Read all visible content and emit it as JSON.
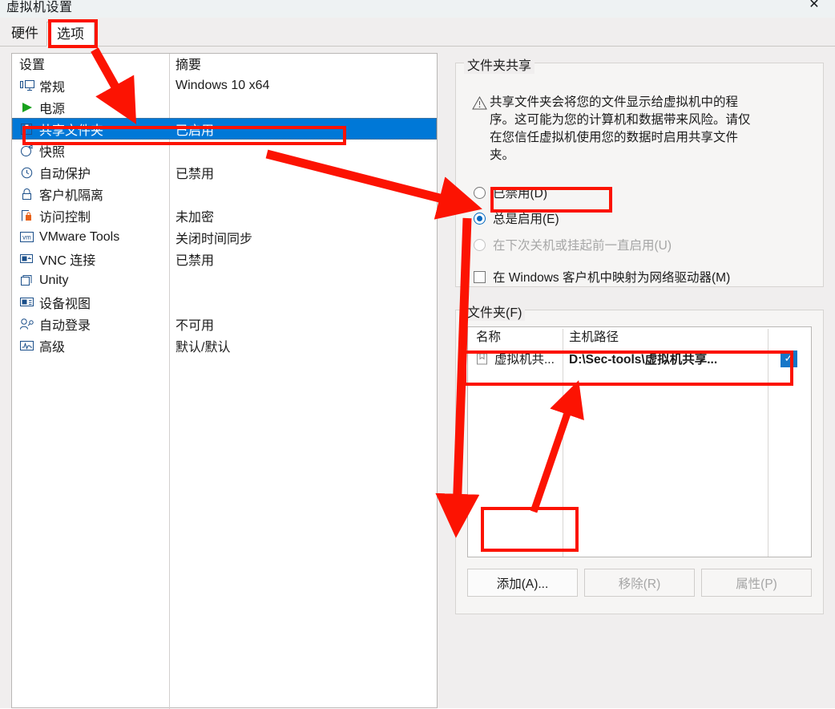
{
  "window": {
    "title": "虚拟机设置",
    "close_label": "✕"
  },
  "tabs": [
    {
      "label": "硬件",
      "active": false
    },
    {
      "label": "选项",
      "active": true
    }
  ],
  "settings_list": {
    "headers": {
      "name": "设置",
      "summary": "摘要"
    },
    "rows": [
      {
        "icon": "monitor-icon",
        "label": "常规",
        "summary": "Windows 10 x64",
        "selected": false
      },
      {
        "icon": "play-icon",
        "label": "电源",
        "summary": "",
        "selected": false
      },
      {
        "icon": "shared-folder-icon",
        "label": "共享文件夹",
        "summary": "已启用",
        "selected": true
      },
      {
        "icon": "snapshot-icon",
        "label": "快照",
        "summary": "",
        "selected": false
      },
      {
        "icon": "autoprotect-icon",
        "label": "自动保护",
        "summary": "已禁用",
        "selected": false
      },
      {
        "icon": "lock-icon",
        "label": "客户机隔离",
        "summary": "",
        "selected": false
      },
      {
        "icon": "access-control-icon",
        "label": "访问控制",
        "summary": "未加密",
        "selected": false
      },
      {
        "icon": "vmware-tools-icon",
        "label": "VMware Tools",
        "summary": "关闭时间同步",
        "selected": false
      },
      {
        "icon": "vnc-icon",
        "label": "VNC 连接",
        "summary": "已禁用",
        "selected": false
      },
      {
        "icon": "unity-icon",
        "label": "Unity",
        "summary": "",
        "selected": false
      },
      {
        "icon": "device-view-icon",
        "label": "设备视图",
        "summary": "",
        "selected": false
      },
      {
        "icon": "autologon-icon",
        "label": "自动登录",
        "summary": "不可用",
        "selected": false
      },
      {
        "icon": "advanced-icon",
        "label": "高级",
        "summary": "默认/默认",
        "selected": false
      }
    ]
  },
  "sharing": {
    "group_title": "文件夹共享",
    "warning_icon": "warning-triangle-icon",
    "warning_text": "共享文件夹会将您的文件显示给虚拟机中的程序。这可能为您的计算机和数据带来风险。请仅在您信任虚拟机使用您的数据时启用共享文件夹。",
    "options": [
      {
        "label": "已禁用(D)",
        "checked": false,
        "disabled": false
      },
      {
        "label": "总是启用(E)",
        "checked": true,
        "disabled": false
      },
      {
        "label": "在下次关机或挂起前一直启用(U)",
        "checked": false,
        "disabled": true
      }
    ],
    "map_checkbox": {
      "label": "在 Windows 客户机中映射为网络驱动器(M)",
      "checked": false
    }
  },
  "folders": {
    "group_title": "文件夹(F)",
    "columns": [
      "名称",
      "主机路径",
      ""
    ],
    "rows": [
      {
        "icon": "folder-icon",
        "name": "虚拟机共...",
        "path": "D:\\Sec-tools\\虚拟机共享...",
        "enabled": true,
        "tick": "✓"
      }
    ],
    "buttons": [
      {
        "label": "添加(A)...",
        "disabled": false
      },
      {
        "label": "移除(R)",
        "disabled": true
      },
      {
        "label": "属性(P)",
        "disabled": true
      }
    ]
  },
  "annotations": {
    "accent_color": "#fc1302",
    "highlight_color": "#0078d7"
  }
}
